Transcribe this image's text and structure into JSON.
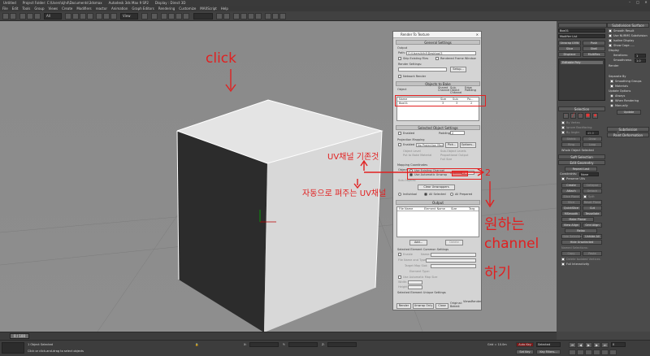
{
  "titlebar": {
    "app": "Untitled",
    "project": "Project Folder: C:\\Users\\kjh4\\Documents\\3dsmax",
    "product": "Autodesk 3ds Max 9 SP2",
    "display": "Display : Direct 3D"
  },
  "menu": [
    "File",
    "Edit",
    "Tools",
    "Group",
    "Views",
    "Create",
    "Modifiers",
    "reactor",
    "Animation",
    "Graph Editors",
    "Rendering",
    "Customize",
    "MAXScript",
    "Help"
  ],
  "toolbar": {
    "selection_filter": "All",
    "view_dropdown": "View"
  },
  "viewport": {
    "label": "Perspective"
  },
  "dialog": {
    "title": "Render To Texture",
    "general_settings": "General Settings",
    "output_label": "Output",
    "path_label": "Path:",
    "path_value": "G:\\Users\\kjh4\\Desktop\\3",
    "skip_existing": "Skip Existing Files",
    "rendered_frame_window": "Rendered Frame Window",
    "render_settings": "Render Settings:",
    "setup": "Setup...",
    "network_render": "Network Render",
    "objects_to_bake": "Objects to Bake",
    "col_object": "Object",
    "col_shared": "Shared Channel",
    "col_subobject": "Sub-Object Channel",
    "col_edge": "Edge Padding",
    "table_header_name": "Name",
    "table_header_size": "Size",
    "table_header_sub": "Sub",
    "table_header_pad": "Pa...",
    "row_object": "Box01",
    "row_channel": "3",
    "row_sub": "3",
    "row_pad": "2",
    "selected_object_settings": "Selected Object Settings",
    "enabled": "Enabled",
    "padding_label": "Padding:",
    "padding_value": "2",
    "projection_mapping": "Projection Mapping",
    "projection_enabled": "Enabled",
    "projection_modifier": "No Projection Modifier",
    "pick": "Pick...",
    "options": "Options...",
    "object_level": "Object Level",
    "sub_object_levels": "Sub-Object Levels",
    "put_to_bake_material": "Put to Bake Material",
    "proportional_output": "Proportional Output",
    "full_size": "Full Size",
    "mapping_coordinates": "Mapping Coordinates",
    "object_label": "Object:",
    "use_existing_channel": "Use Existing Channel",
    "use_automatic_unwrap": "Use Automatic Unwrap",
    "channel_label": "Channel:",
    "channel_value": "3",
    "sub_objects_label": "Sub-Objects:",
    "clear_unwrappers": "Clear Unwrappers",
    "individual": "Individual",
    "all_selected": "All Selected",
    "all_prepared": "All Prepared",
    "output_section": "Output",
    "file_name": "File Name",
    "element_name": "Element Name",
    "size_col": "Size",
    "target_col": "Targ",
    "add": "Add...",
    "delete": "Delete",
    "selected_element_common": "Selected Element Common Settings",
    "enable": "Enable",
    "name_label": "Name:",
    "file_name_type": "File Name and Type:",
    "target_map_slot": "Target Map Slot:",
    "element_type": "Element Type:",
    "use_automatic_map_size": "Use Automatic Map Size",
    "width": "Width:",
    "height": "Height:",
    "selected_element_unique": "Selected Element Unique Settings",
    "render": "Render",
    "unwrap_only": "Unwrap Only",
    "close": "Close",
    "original_baked": "Original: Baked:",
    "views": "Views",
    "render_col": "Render"
  },
  "cmdpanel": {
    "object_name": "Box01",
    "modifier_list": "Modifier List",
    "unwrap_uvw": "Unwrap UVW",
    "push": "Push",
    "slice": "Slice",
    "shell": "Shell",
    "displace": "Displace",
    "multires": "MultiRes",
    "editable_poly": "Editable Poly",
    "subdivision_surface": "Subdivision Surface",
    "smooth_result": "Smooth Result",
    "use_nurms": "Use NURMS Subdivision",
    "isoline_display": "Isoline Display",
    "show_cage": "Show Cage......",
    "display": "Display",
    "iterations_label": "Iterations:",
    "iterations_value": "1",
    "smoothness_label": "Smoothness:",
    "smoothness_value": "1.0",
    "render": "Render",
    "separate_by": "Separate By",
    "smoothing_groups": "Smoothing Groups",
    "materials": "Materials",
    "update_options": "Update Options",
    "always": "Always",
    "when_rendering": "When Rendering",
    "manually": "Manually",
    "update": "Update",
    "selection": "Selection",
    "by_vertex": "By Vertex",
    "ignore_backfacing": "Ignore Backfacing",
    "by_angle": "By Angle:",
    "angle_value": "45.0",
    "shrink": "Shrink",
    "grow": "Grow",
    "ring": "Ring",
    "loop": "Loop",
    "whole_selected": "Whole Object Selected",
    "soft_selection": "Soft Selection",
    "edit_geometry": "Edit Geometry",
    "repeat_last": "Repeat Last",
    "constraints": "Constraints:",
    "constraints_value": "None",
    "preserve_uvs": "Preserve UVs",
    "create": "Create",
    "collapse": "Collapse",
    "attach": "Attach",
    "detach": "Detach",
    "slice_plane": "Slice Plane",
    "split": "Split",
    "slice_btn": "Slice",
    "reset_plane": "Reset Plane",
    "quickslice": "QuickSlice",
    "cut": "Cut",
    "msmooth": "MSmooth",
    "tessellate": "Tessellate",
    "make_planar": "Make Planar",
    "view_align": "View Align",
    "grid_align": "Grid Align",
    "relax": "Relax",
    "hide_selected": "Hide Selected",
    "unhide_all": "Unhide All",
    "hide_unselected": "Hide Unselected",
    "named_selections": "Named Selections:",
    "copy": "Copy",
    "paste": "Paste",
    "delete_isolated": "Delete Isolated Vertices",
    "full_interactivity": "Full Interactivity",
    "subdivision_displacement": "Subdivision Displacement",
    "paint_deformation": "Paint Deformation"
  },
  "trackbar": {
    "frame": "0 / 100"
  },
  "status": {
    "selected": "1 Object Selected",
    "hint": "Click or click-and-drag to select objects",
    "x_label": "X:",
    "x_value": "",
    "y_label": "Y:",
    "y_value": "",
    "z_label": "Z:",
    "z_value": "",
    "grid": "Grid = 10.0m",
    "auto_key": "Auto Key",
    "set_key": "Set Key",
    "selected_dropdown": "Selected",
    "key_filters": "Key Filters...",
    "frame_value": "0"
  },
  "annotations": {
    "click": "click",
    "uv_existing": "UV채널 기존것",
    "uv_auto": "자동으로 펴주는 UV채널",
    "number_2": "2",
    "want_1": "원하는",
    "want_2": "channel",
    "want_3": "하기"
  },
  "colors": {
    "annotation": "#e12020",
    "viewport_bg": "#8c8c8c",
    "dialog_bg": "#d4d4d4",
    "panel_bg": "#4b4b4b"
  }
}
